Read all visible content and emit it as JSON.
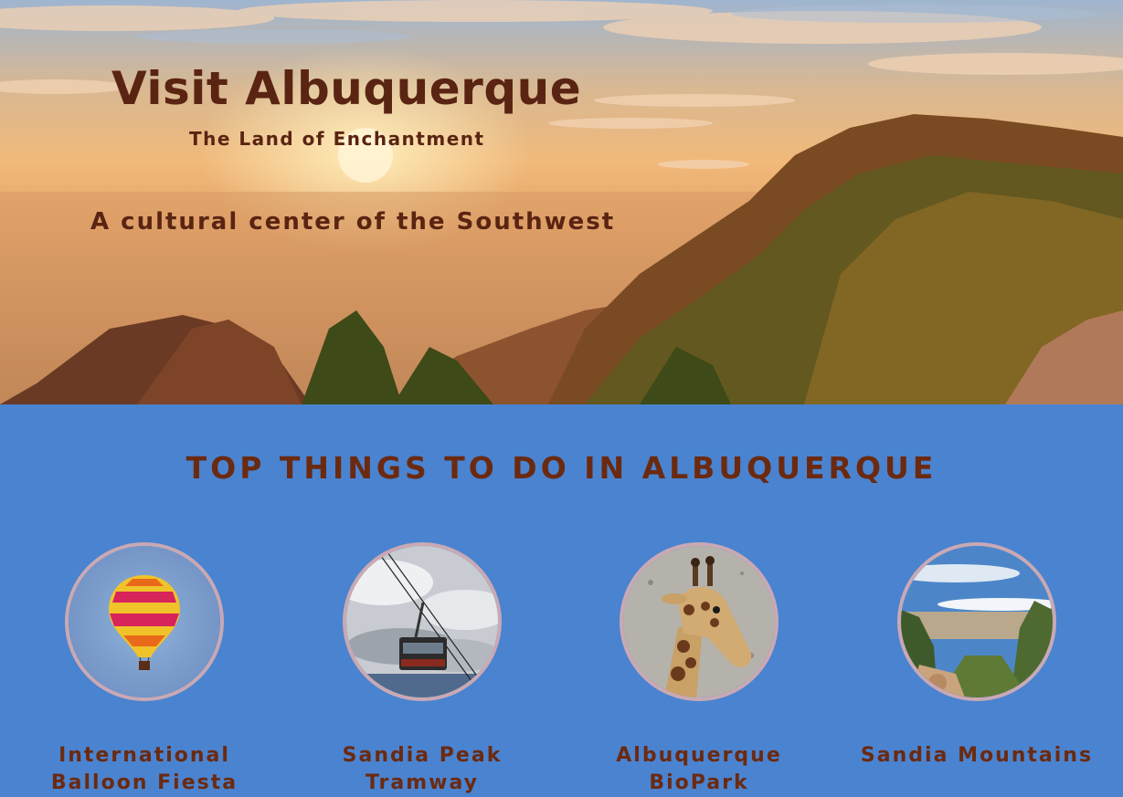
{
  "hero": {
    "title": "Visit Albuquerque",
    "subtitle": "The Land of Enchantment",
    "tagline": "A cultural center of the Southwest",
    "image_icon": "sandia-mountains-sunset-image"
  },
  "section": {
    "title": "TOP THINGS TO DO IN ALBUQUERQUE"
  },
  "attractions": [
    {
      "label_line1": "International",
      "label_line2": "Balloon Fiesta",
      "icon": "hot-air-balloon-image"
    },
    {
      "label_line1": "Sandia Peak",
      "label_line2": "Tramway",
      "icon": "tramway-car-image"
    },
    {
      "label_line1": "Albuquerque",
      "label_line2": "BioPark",
      "icon": "giraffe-image"
    },
    {
      "label_line1": "Sandia Mountains",
      "label_line2": "",
      "icon": "mountain-valley-image"
    }
  ],
  "colors": {
    "page_background": "#4a83d0",
    "heading_brown": "#6b2a10",
    "thumb_border": "#c9a9b4"
  }
}
